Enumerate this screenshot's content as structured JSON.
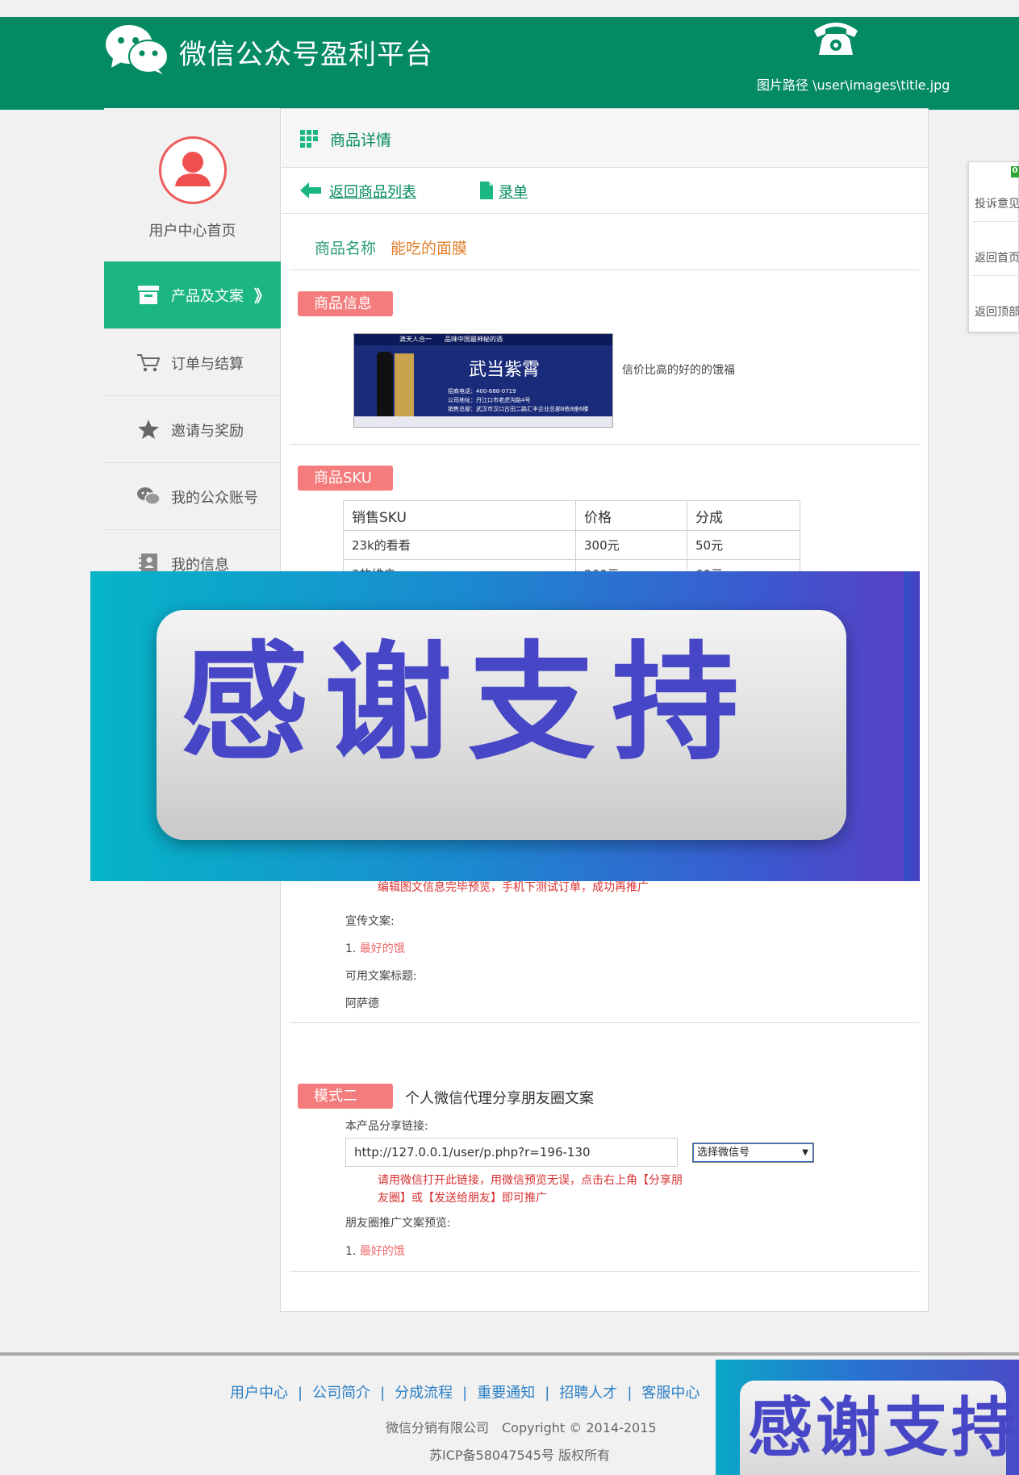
{
  "header": {
    "site_title": "微信公众号盈利平台",
    "image_path": "图片路径 \\user\\images\\title.jpg",
    "bg_color": "#058b63"
  },
  "sidebar": {
    "avatar_label": "用户中心首页",
    "items": [
      {
        "label": "产品及文案",
        "icon": "archive-box-icon",
        "active": true,
        "arrow": "》"
      },
      {
        "label": "订单与结算",
        "icon": "cart-icon",
        "active": false
      },
      {
        "label": "邀请与奖励",
        "icon": "star-icon",
        "active": false
      },
      {
        "label": "我的公众账号",
        "icon": "wechat-icon",
        "active": false
      },
      {
        "label": "我的信息",
        "icon": "contact-card-icon",
        "active": false
      }
    ],
    "active_color": "#1cb584"
  },
  "breadcrumb": {
    "title": "商品详情"
  },
  "toolbar": {
    "back_label": "返回商品列表",
    "record_label": "录单"
  },
  "product": {
    "name_label": "商品名称",
    "name_value": "能吃的面膜",
    "info_tag": "商品信息",
    "image_caption": "信价比高的好的的饿福",
    "image": {
      "top_line": "滴天人合一　　品味中国最神秘的酒",
      "brand": "武当紫霄",
      "lines": [
        "招商电话：400-688-0719",
        "公司地址：丹江口市老虎沟路4号",
        "销售总部：武汉市汉口古田二路汇丰企业总部8栋8座6楼"
      ]
    }
  },
  "sku": {
    "tag": "商品SKU",
    "headers": [
      "销售SKU",
      "价格",
      "分成"
    ],
    "rows": [
      [
        "23k的看看",
        "300元",
        "50元"
      ],
      [
        "3的维亲",
        "260元",
        "60元"
      ]
    ]
  },
  "overlay_banner": {
    "text": "感谢支持"
  },
  "mode1": {
    "preview_tip": "编辑图文信息完毕预览，手机下测试订单，成功再推广",
    "copy_label": "宣传文案:",
    "copy_items": [
      {
        "num": "1.",
        "text": "最好的饿"
      }
    ],
    "title_label": "可用文案标题:",
    "title_value": "阿萨德"
  },
  "mode2": {
    "tag": "模式二",
    "title": "个人微信代理分享朋友圈文案",
    "share_label": "本产品分享链接:",
    "share_url": "http://127.0.0.1/user/p.php?r=196-130",
    "select_value": "选择微信号",
    "tip_line1": "请用微信打开此链接，用微信预览无误，点击右上角【分享朋",
    "tip_line2": "友圈】或【发送给朋友】即可推广",
    "preview_label": "朋友圈推广文案预览:",
    "preview_items": [
      {
        "num": "1.",
        "text": "最好的饿"
      }
    ]
  },
  "float_panel": {
    "badge": "0",
    "items": [
      "投诉意见",
      "返回首页",
      "返回顶部"
    ]
  },
  "footer": {
    "links": [
      "用户中心",
      "公司简介",
      "分成流程",
      "重要通知",
      "招聘人才",
      "客服中心"
    ],
    "copyright": "微信分销有限公司　Copyright © 2014-2015",
    "icp": "苏ICP备58047545号 版权所有"
  }
}
